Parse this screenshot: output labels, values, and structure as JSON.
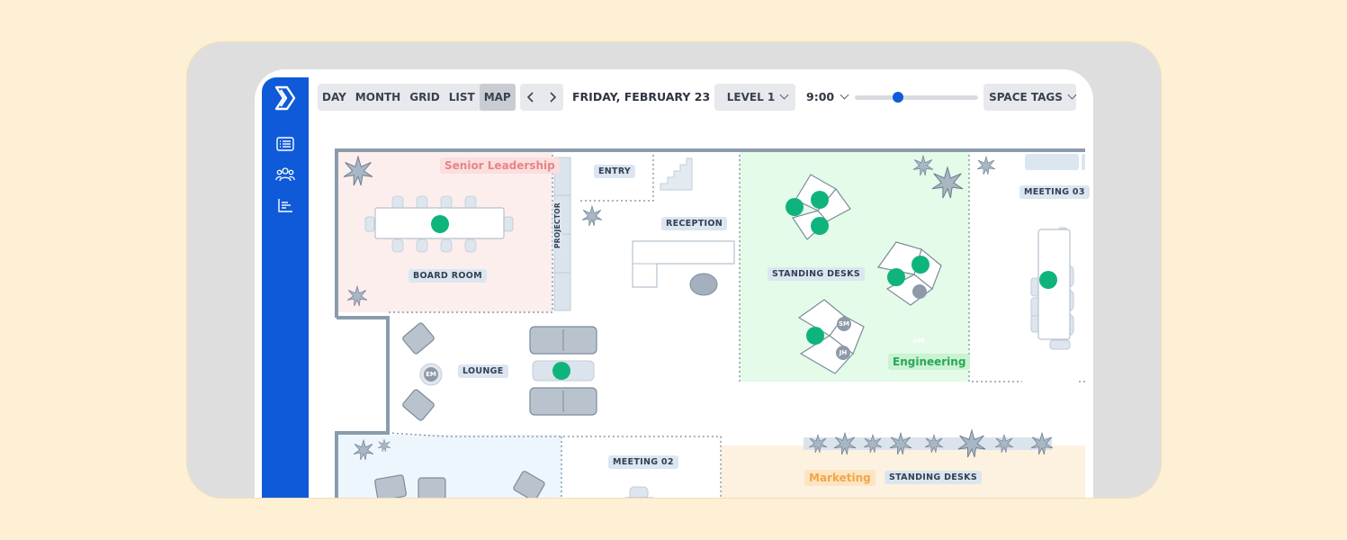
{
  "toolbar": {
    "views": [
      "DAY",
      "MONTH",
      "GRID",
      "LIST",
      "MAP"
    ],
    "active_view": "MAP",
    "date": "FRIDAY, FEBRUARY 23",
    "level": "LEVEL 1",
    "time": "9:00",
    "time_slider_fraction": 0.35,
    "space_tags": "SPACE TAGS"
  },
  "map": {
    "zones": {
      "senior_leadership": "Senior Leadership",
      "engineering": "Engineering",
      "marketing": "Marketing"
    },
    "rooms": {
      "board_room": "BOARD ROOM",
      "projector": "PROJECTOR",
      "entry": "ENTRY",
      "reception": "RECEPTION",
      "standing_desks_eng": "STANDING DESKS",
      "meeting_03": "MEETING 03",
      "lounge": "LOUNGE",
      "meeting_02": "MEETING 02",
      "standing_desks_mkt": "STANDING DESKS"
    },
    "avatars": {
      "hm": "HM",
      "sm": "SM",
      "jh": "JH",
      "em": "EM"
    }
  },
  "colors": {
    "brand_blue": "#0e5ad8",
    "occupied_green": "#0fb47c",
    "senior_leadership_bg": "#fdeeee",
    "engineering_bg": "#e3fbe8",
    "marketing_bg": "#fdf1e0",
    "lounge_zone_bg": "#eef6fd"
  },
  "icons": [
    "logo-icon",
    "list-icon",
    "people-icon",
    "chart-icon",
    "chevron-left-icon",
    "chevron-right-icon",
    "chevron-down-icon",
    "plant-icon"
  ]
}
